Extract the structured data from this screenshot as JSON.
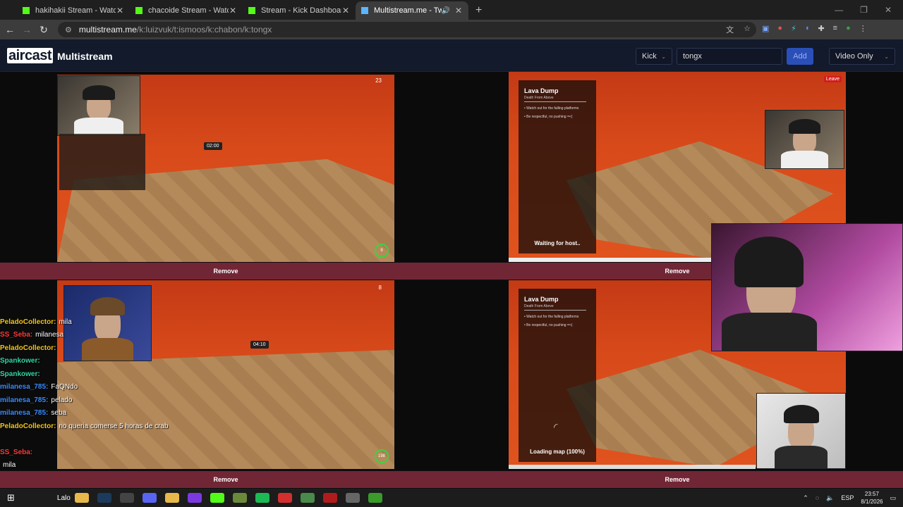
{
  "tabs": [
    {
      "title": "hakihakii Stream - Watch Live o",
      "favicon_color": "#53fc18"
    },
    {
      "title": "chacoide Stream - Watch Live o",
      "favicon_color": "#53fc18"
    },
    {
      "title": "Stream - Kick Dashboard",
      "favicon_color": "#53fc18"
    },
    {
      "title": "Multistream.me - Twitch.tv",
      "favicon_color": "#5bb6ff"
    }
  ],
  "address": {
    "site": "multistream.me",
    "path": "/k:luizvuk/t:ismoos/k:chabon/k:tongx"
  },
  "header": {
    "logo": "aircast",
    "app_name": "Multistream",
    "platform_select": "Kick",
    "channel_input": "tongx",
    "add_label": "Add",
    "mode_select": "Video Only"
  },
  "streams": [
    {
      "hud_count": "23",
      "timer": "02:00",
      "remove_label": "Remove",
      "ring": "9"
    },
    {
      "panel_title": "Lava Dump",
      "panel_subtitle": "Death From Above",
      "rule1": "• Watch out for the falling platforms",
      "rule2": "• Be respectful, no pushing =<(",
      "status": "Waiting for host..",
      "leave_label": "Leave",
      "remove_label": "Remove"
    },
    {
      "hud_count": "8",
      "timer": "04:10",
      "remove_label": "Remove",
      "ring": "198"
    },
    {
      "panel_title": "Lava Dump",
      "panel_subtitle": "Death From Above",
      "rule1": "• Watch out for the falling platforms",
      "rule2": "• Be respectful, no pushing =<(",
      "status": "Loading map (100%)",
      "remove_label": "Remove"
    }
  ],
  "chat": [
    {
      "user": "PeladoCollector:",
      "text": "mila",
      "color": "#f5c518"
    },
    {
      "user": "SS_Seba:",
      "text": "milanesa",
      "color": "#ff3b3b"
    },
    {
      "user": "PeladoCollector:",
      "text": "",
      "color": "#f5c518"
    },
    {
      "user": "Spankower:",
      "text": "",
      "color": "#33d6a6"
    },
    {
      "user": "Spankower:",
      "text": "",
      "color": "#33d6a6"
    },
    {
      "user": "milanesa_785:",
      "text": "FaQNdo",
      "color": "#3a8cff"
    },
    {
      "user": "milanesa_785:",
      "text": "pelado",
      "color": "#3a8cff"
    },
    {
      "user": "milanesa_785:",
      "text": "seba",
      "color": "#3a8cff"
    },
    {
      "user": "PeladoCollector:",
      "text": "no queria comerse 5 horas de crab",
      "color": "#f5c518"
    },
    {
      "user": "",
      "text": "",
      "color": "#ffffff"
    },
    {
      "user": "SS_Seba:",
      "text": "",
      "color": "#ff3b3b"
    },
    {
      "user": "",
      "text": "mila",
      "color": "#ffffff"
    }
  ],
  "taskbar": {
    "label": "Lalo",
    "lang": "ESP",
    "time": "23:57",
    "date": "8/1/2026"
  }
}
